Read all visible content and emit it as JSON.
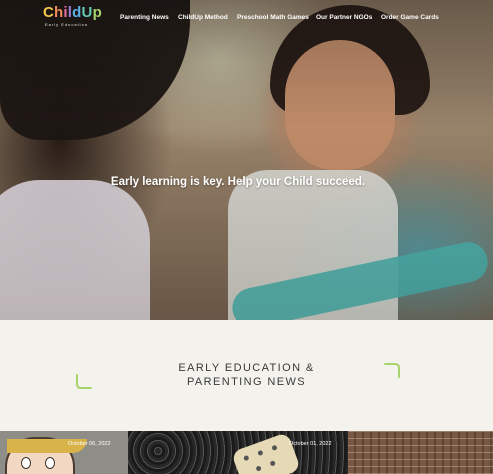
{
  "brand": {
    "logo_letters": [
      "C",
      "h",
      "i",
      "l",
      "d",
      "U",
      "p"
    ],
    "logo_colors": [
      "#f2c84b",
      "#f08a5d",
      "#e96fa6",
      "#9a7bd8",
      "#5ab0e6",
      "#62c9b5",
      "#a7d46a"
    ],
    "tagline": "Early Education"
  },
  "nav": {
    "items": [
      "Parenting News",
      "ChildUp Method",
      "Preschool Math Games",
      "Our Partner NGOs",
      "Order Game Cards"
    ]
  },
  "hero": {
    "headline": "Early learning is key. Help your Child succeed."
  },
  "section": {
    "title_line1": "EARLY EDUCATION &",
    "title_line2": "PARENTING NEWS",
    "accent_color": "#a7d46a"
  },
  "cards": [
    {
      "date": "October 06, 2022"
    },
    {
      "date": "October 01, 2022"
    },
    {
      "date": ""
    }
  ]
}
